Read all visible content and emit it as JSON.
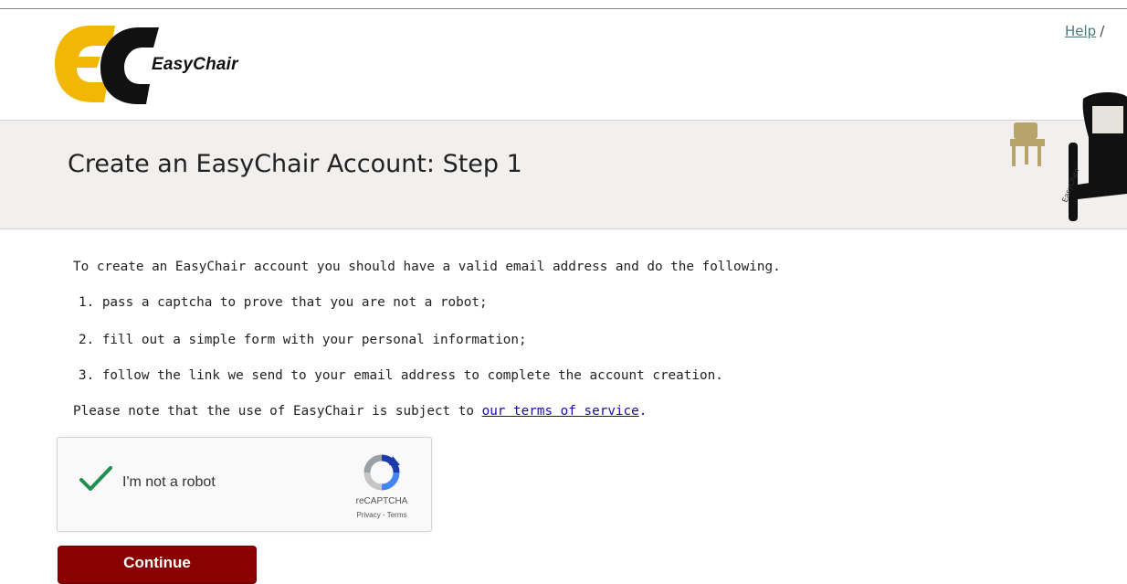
{
  "header": {
    "logo_text": "EasyChair",
    "nav": {
      "help_label": "Help",
      "separator": "/"
    }
  },
  "page": {
    "title": "Create an EasyChair Account: Step 1"
  },
  "content": {
    "intro": "To create an EasyChair account you should have a valid email address and do the following.",
    "steps": [
      "1. pass a captcha to prove that you are not a robot;",
      "2. fill out a simple form with your personal information;",
      "3. follow the link we send to your email address to complete the account creation."
    ],
    "terms_prefix": "Please note that the use of EasyChair is subject to ",
    "terms_link": "our terms of service",
    "terms_suffix": "."
  },
  "captcha": {
    "label": "I'm not a robot",
    "brand": "reCAPTCHA",
    "privacy": "Privacy",
    "links_sep": " - ",
    "terms": "Terms",
    "checked": true,
    "check_color": "#1e8f4e"
  },
  "actions": {
    "continue_label": "Continue"
  },
  "colors": {
    "continue_bg": "#8b0000",
    "link": "#1a0dab",
    "band_bg": "#f1f0ee",
    "logo_yellow": "#f2b705"
  }
}
